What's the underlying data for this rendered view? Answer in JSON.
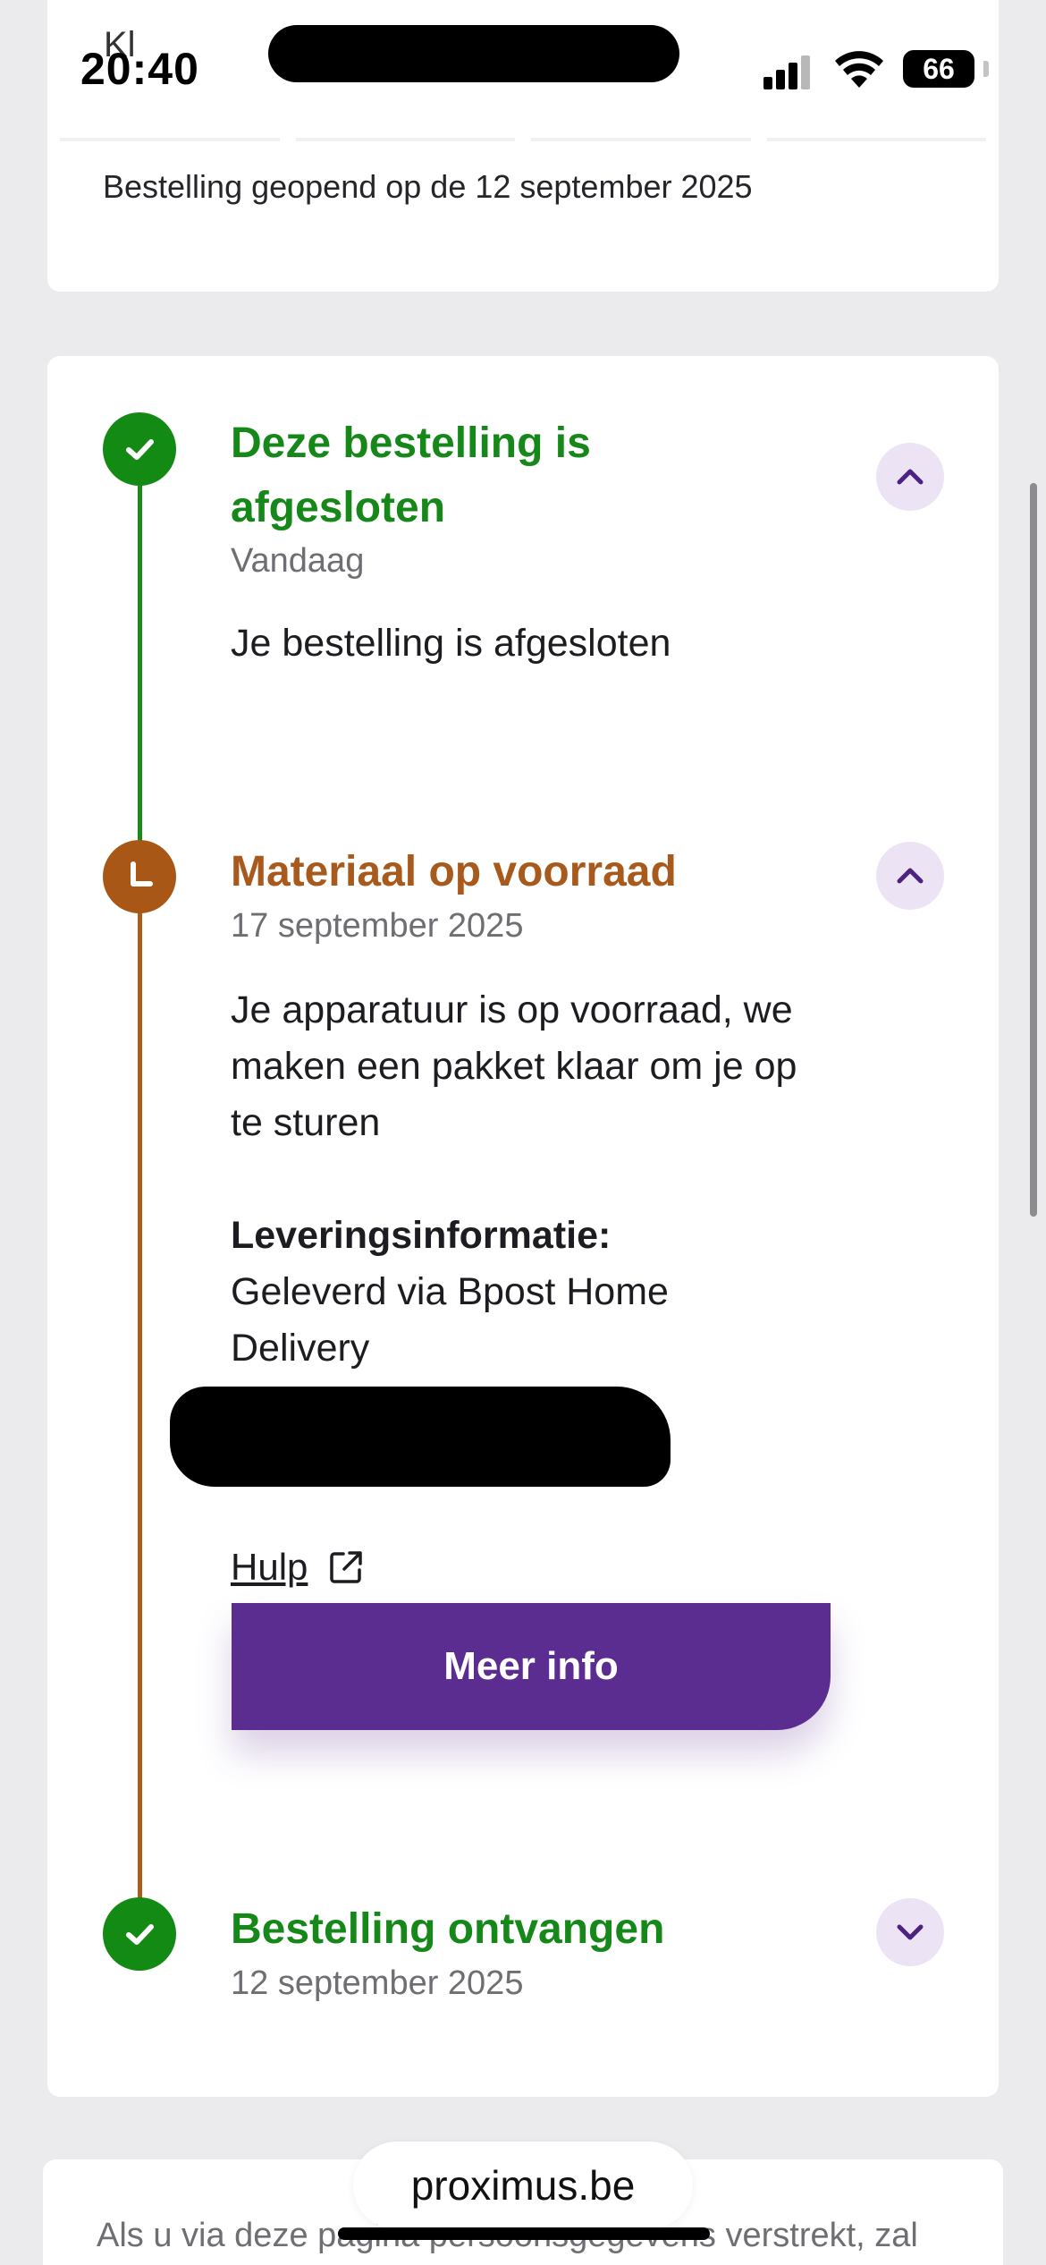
{
  "status_bar": {
    "time": "20:40",
    "carrier_partial": "Kl",
    "battery": "66"
  },
  "order_header": {
    "opened_text": "Bestelling geopend op de 12 september 2025"
  },
  "timeline": {
    "steps": [
      {
        "status": "completed",
        "title_line1": "Deze bestelling is",
        "title_line2": "afgesloten",
        "date": "Vandaag",
        "description": "Je bestelling is afgesloten",
        "expanded": true,
        "color": "#16881a"
      },
      {
        "status": "in-progress",
        "title": "Materiaal op voorraad",
        "date": "17 september 2025",
        "description_line1": "Je apparatuur is op voorraad, we",
        "description_line2": "maken een pakket klaar om je op",
        "description_line3": "te sturen",
        "delivery_heading": "Leveringsinformatie:",
        "delivery_line1": "Geleverd via Bpost Home",
        "delivery_line2": "Delivery",
        "help_link": "Hulp",
        "more_info_button": "Meer info",
        "expanded": true,
        "color": "#a8591c"
      },
      {
        "status": "completed",
        "title": "Bestelling ontvangen",
        "date": "12 september 2025",
        "expanded": false,
        "color": "#16881a"
      }
    ]
  },
  "footer": {
    "privacy_text": "Als u via deze pagina persoonsgegevens verstrekt, zal"
  },
  "browser": {
    "url": "proximus.be"
  },
  "colors": {
    "accent_purple": "#5c2d91",
    "success_green": "#16881a",
    "pending_brown": "#a8591c"
  }
}
